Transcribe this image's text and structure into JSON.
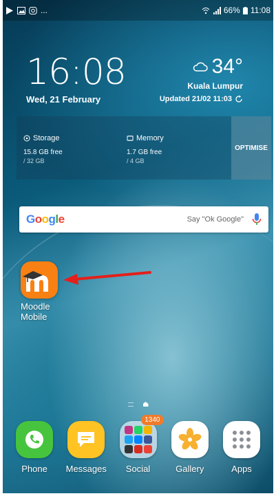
{
  "status_bar": {
    "left_icons": [
      "play-store-icon",
      "image-icon",
      "instagram-icon"
    ],
    "overflow": "...",
    "battery": "66%",
    "time": "11:08"
  },
  "clock_widget": {
    "time": "16:08",
    "date": "Wed, 21 February"
  },
  "weather_widget": {
    "temperature": "34°",
    "city": "Kuala Lumpur",
    "updated": "Updated 21/02 11:03"
  },
  "smart_manager": {
    "storage": {
      "title": "Storage",
      "free": "15.8 GB free",
      "total": "/ 32 GB"
    },
    "memory": {
      "title": "Memory",
      "free": "1.7 GB free",
      "total": "/ 4 GB"
    },
    "optimise_label": "OPTIMISE"
  },
  "google_search": {
    "logo": "Google",
    "hint": "Say \"Ok Google\""
  },
  "home_apps": [
    {
      "label_line1": "Moodle",
      "label_line2": "Mobile",
      "color": "#f98012"
    }
  ],
  "dock": [
    {
      "label": "Phone",
      "icon": "phone-icon"
    },
    {
      "label": "Messages",
      "icon": "messages-icon"
    },
    {
      "label": "Social",
      "icon": "social-folder-icon",
      "badge": "1340"
    },
    {
      "label": "Gallery",
      "icon": "gallery-icon"
    },
    {
      "label": "Apps",
      "icon": "apps-grid-icon"
    }
  ],
  "colors": {
    "google_blue": "#4285F4",
    "google_red": "#EA4335",
    "google_yellow": "#FBBC05",
    "google_green": "#34A853",
    "annotation_arrow": "#e3201b"
  }
}
